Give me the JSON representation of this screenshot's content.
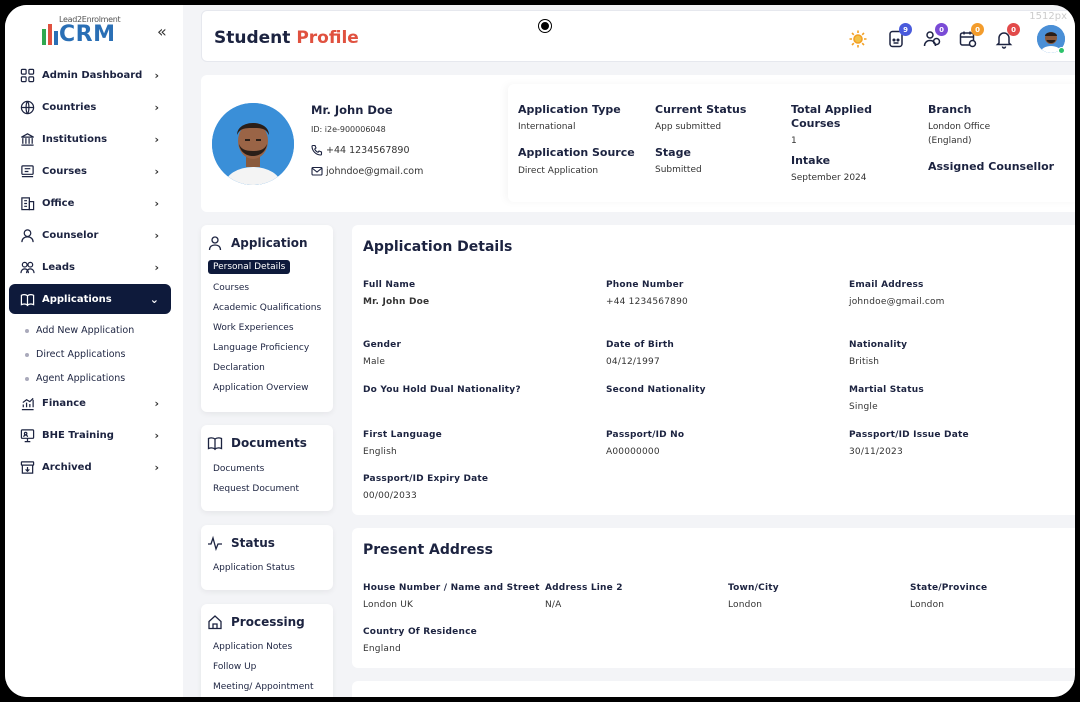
{
  "viewport_label": "1512px",
  "brand": {
    "top": "Lead2Enrolment",
    "name": "CRM"
  },
  "sidebar": {
    "items": [
      {
        "label": "Admin Dashboard",
        "icon": "grid-icon"
      },
      {
        "label": "Countries",
        "icon": "globe-icon"
      },
      {
        "label": "Institutions",
        "icon": "bank-icon"
      },
      {
        "label": "Courses",
        "icon": "book-stack-icon"
      },
      {
        "label": "Office",
        "icon": "building-icon"
      },
      {
        "label": "Counselor",
        "icon": "person-icon"
      },
      {
        "label": "Leads",
        "icon": "group-icon"
      },
      {
        "label": "Applications",
        "icon": "open-book-icon"
      },
      {
        "label": "Finance",
        "icon": "chart-icon"
      },
      {
        "label": "BHE Training",
        "icon": "presentation-icon"
      },
      {
        "label": "Archived",
        "icon": "archive-icon"
      }
    ],
    "sub_items": [
      "Add New Application",
      "Direct Applications",
      "Agent Applications"
    ]
  },
  "header": {
    "title_main": "Student",
    "title_accent": "Profile",
    "badges": [
      {
        "count": "9",
        "color": "#4a5bdc"
      },
      {
        "count": "0",
        "color": "#7a4bd6"
      },
      {
        "count": "0",
        "color": "#f39c2c"
      },
      {
        "count": "0",
        "color": "#e24a4a"
      }
    ]
  },
  "profile": {
    "name": "Mr. John Doe",
    "id": "ID: i2e-900006048",
    "phone": "+44 1234567890",
    "email": "johndoe@gmail.com"
  },
  "info": {
    "application_type_label": "Application Type",
    "application_type": "International",
    "application_source_label": "Application Source",
    "application_source": "Direct Application",
    "current_status_label": "Current Status",
    "current_status": "App submitted",
    "stage_label": "Stage",
    "stage": "Submitted",
    "total_applied_label_1": "Total Applied",
    "total_applied_label_2": "Courses",
    "total_applied": "1",
    "intake_label": "Intake",
    "intake": "September 2024",
    "branch_label": "Branch",
    "branch_1": "London Office",
    "branch_2": "(England)",
    "assigned_counsellor_label": "Assigned Counsellor"
  },
  "menus": {
    "application": {
      "title": "Application",
      "items": [
        "Personal Details",
        "Courses",
        "Academic Qualifications",
        "Work Experiences",
        "Language Proficiency",
        "Declaration",
        "Application Overview"
      ]
    },
    "documents": {
      "title": "Documents",
      "items": [
        "Documents",
        "Request Document"
      ]
    },
    "status": {
      "title": "Status",
      "items": [
        "Application Status"
      ]
    },
    "processing": {
      "title": "Processing",
      "items": [
        "Application Notes",
        "Follow Up",
        "Meeting/ Appointment"
      ]
    }
  },
  "application_details": {
    "title": "Application Details",
    "fields": [
      {
        "label": "Full Name",
        "value": "Mr.  John Doe"
      },
      {
        "label": "Phone Number",
        "value": "+44 1234567890"
      },
      {
        "label": "Email Address",
        "value": "johndoe@gmail.com"
      },
      {
        "label": "Gender",
        "value": "Male"
      },
      {
        "label": "Date of Birth",
        "value": "04/12/1997"
      },
      {
        "label": "Nationality",
        "value": "British"
      },
      {
        "label": "Do You Hold Dual Nationality?",
        "value": ""
      },
      {
        "label": "Second Nationality",
        "value": ""
      },
      {
        "label": "Martial Status",
        "value": "Single"
      },
      {
        "label": "First Language",
        "value": "English"
      },
      {
        "label": "Passport/ID No",
        "value": "A00000000"
      },
      {
        "label": "Passport/ID Issue Date",
        "value": "30/11/2023"
      },
      {
        "label": "Passport/ID Expiry Date",
        "value": "00/00/2033"
      }
    ]
  },
  "present_address": {
    "title": "Present Address",
    "fields": [
      {
        "label": "House Number / Name and Street",
        "value": "London UK"
      },
      {
        "label": "Address Line 2",
        "value": "N/A"
      },
      {
        "label": "Town/City",
        "value": "London"
      },
      {
        "label": "State/Province",
        "value": "London"
      },
      {
        "label": "Country Of Residence",
        "value": "England"
      }
    ]
  }
}
